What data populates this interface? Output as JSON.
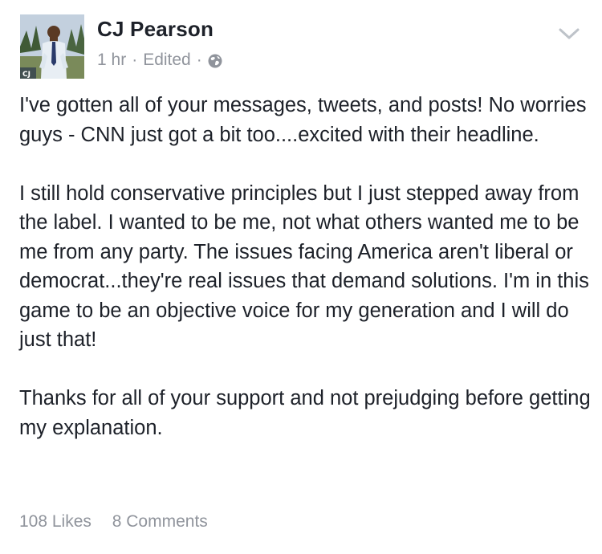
{
  "author": {
    "name": "CJ Pearson",
    "avatar_overlay": "CJ"
  },
  "meta": {
    "time": "1 hr",
    "separator": "·",
    "edited": "Edited",
    "audience_icon": "globe-icon"
  },
  "post": {
    "paragraphs": [
      "I've gotten all of your messages, tweets, and posts! No worries guys - CNN just got a bit too....excited with their headline.",
      "I still hold conservative principles but I just stepped away from the label. I wanted to be me, not what others wanted me to be me from any party.  The issues facing America aren't liberal or democrat...they're real issues that demand solutions. I'm in this game to be an objective voice for my generation and I will do just that!",
      "Thanks for all of your support and not prejudging before getting my explanation."
    ]
  },
  "footer": {
    "likes": "108 Likes",
    "comments": "8 Comments"
  },
  "colors": {
    "text": "#1d2129",
    "muted": "#90949c"
  }
}
